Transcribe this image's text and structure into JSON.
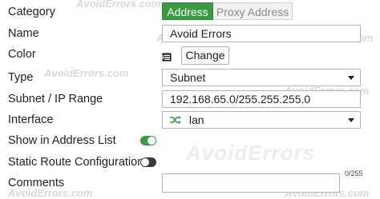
{
  "watermark": "AvoidErrors.com",
  "watermark_big": "AvoidErrors",
  "fields": {
    "category": {
      "label": "Category",
      "options": [
        "Address",
        "Proxy Address"
      ],
      "selected": "Address"
    },
    "name": {
      "label": "Name",
      "value": "Avoid Errors"
    },
    "color": {
      "label": "Color",
      "button": "Change",
      "icon": "color-swatch-icon"
    },
    "type": {
      "label": "Type",
      "value": "Subnet"
    },
    "subnet": {
      "label": "Subnet / IP Range",
      "value": "192.168.65.0/255.255.255.0"
    },
    "interface": {
      "label": "Interface",
      "value": "lan",
      "icon": "shuffle-icon"
    },
    "show_in_list": {
      "label": "Show in Address List",
      "enabled": true
    },
    "static_route": {
      "label": "Static Route Configuration",
      "enabled": false
    },
    "comments": {
      "label": "Comments",
      "value": "",
      "counter": "0/255"
    }
  },
  "colors": {
    "accent": "#3a9a3f"
  }
}
